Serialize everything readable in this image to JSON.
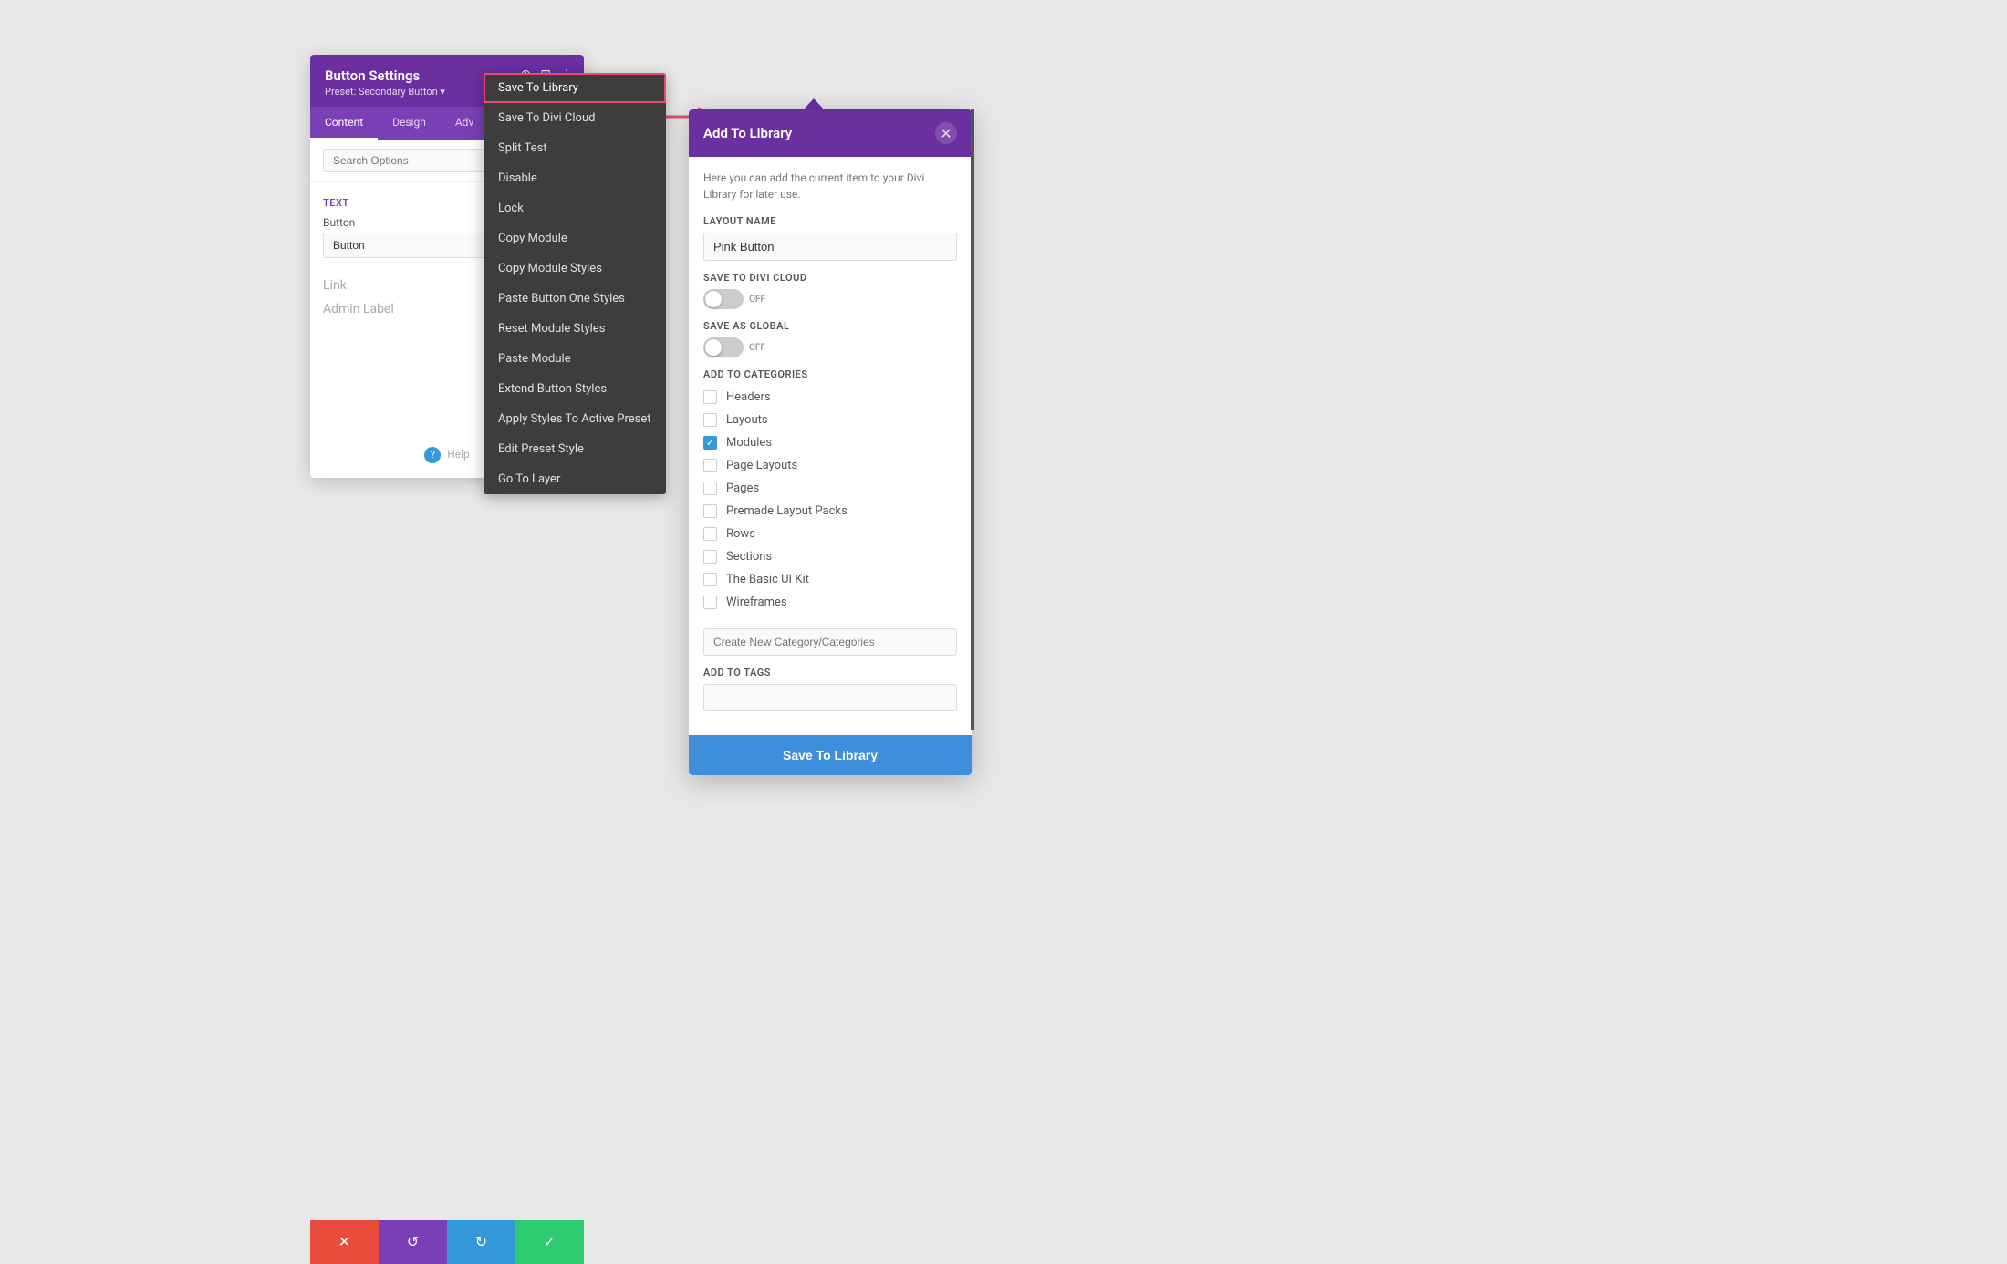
{
  "buttonSettingsPanel": {
    "title": "Button Settings",
    "subtitle": "Preset: Secondary Button ▾",
    "tabs": [
      "Content",
      "Design",
      "Adv"
    ],
    "activeTab": "Content",
    "searchPlaceholder": "Search Options",
    "sections": {
      "text": {
        "label": "Text",
        "buttonLabel": "Button",
        "buttonValue": "Button"
      },
      "link": "Link",
      "adminLabel": "Admin Label"
    },
    "helpLabel": "Help",
    "footer": {
      "cancel": "✕",
      "undo": "↺",
      "redo": "↻",
      "save": "✓"
    }
  },
  "contextMenu": {
    "items": [
      {
        "label": "Save To Library",
        "highlighted": true
      },
      {
        "label": "Save To Divi Cloud",
        "highlighted": false
      },
      {
        "label": "Split Test",
        "highlighted": false
      },
      {
        "label": "Disable",
        "highlighted": false
      },
      {
        "label": "Lock",
        "highlighted": false
      },
      {
        "label": "Copy Module",
        "highlighted": false
      },
      {
        "label": "Copy Module Styles",
        "highlighted": false
      },
      {
        "label": "Paste Button One Styles",
        "highlighted": false
      },
      {
        "label": "Reset Module Styles",
        "highlighted": false
      },
      {
        "label": "Paste Module",
        "highlighted": false
      },
      {
        "label": "Extend Button Styles",
        "highlighted": false
      },
      {
        "label": "Apply Styles To Active Preset",
        "highlighted": false
      },
      {
        "label": "Edit Preset Style",
        "highlighted": false
      },
      {
        "label": "Go To Layer",
        "highlighted": false
      }
    ]
  },
  "addLibraryModal": {
    "title": "Add To Library",
    "description": "Here you can add the current item to your Divi Library for later use.",
    "layoutNameLabel": "Layout Name",
    "layoutNameValue": "Pink Button",
    "saveToDiviCloudLabel": "Save To Divi Cloud",
    "saveToDiviCloudToggle": "OFF",
    "saveAsGlobalLabel": "Save as Global",
    "saveAsGlobalToggle": "OFF",
    "addToCategoriesLabel": "Add To Categories",
    "categories": [
      {
        "label": "Headers",
        "checked": false
      },
      {
        "label": "Layouts",
        "checked": false
      },
      {
        "label": "Modules",
        "checked": true
      },
      {
        "label": "Page Layouts",
        "checked": false
      },
      {
        "label": "Pages",
        "checked": false
      },
      {
        "label": "Premade Layout Packs",
        "checked": false
      },
      {
        "label": "Rows",
        "checked": false
      },
      {
        "label": "Sections",
        "checked": false
      },
      {
        "label": "The Basic UI Kit",
        "checked": false
      },
      {
        "label": "Wireframes",
        "checked": false
      }
    ],
    "newCategoryPlaceholder": "Create New Category/Categories",
    "addToTagsLabel": "Add To Tags",
    "tagsPlaceholder": "",
    "saveButtonLabel": "Save To Library"
  },
  "icons": {
    "crosshair": "⊕",
    "grid": "⊞",
    "dots": "⋮",
    "close": "✕",
    "check": "✓"
  }
}
